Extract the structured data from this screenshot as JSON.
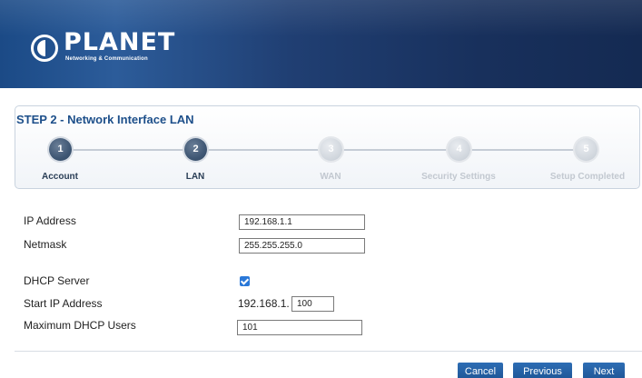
{
  "brand": {
    "logo_text": "PLANET",
    "tagline": "Networking & Communication",
    "colors": {
      "header": "#203f73",
      "accent": "#1d4f8a",
      "button": "#2566a8"
    }
  },
  "wizard": {
    "title": "STEP 2 - Network Interface LAN",
    "current_step": 2,
    "steps": [
      {
        "number": "1",
        "label": "Account",
        "state": "active"
      },
      {
        "number": "2",
        "label": "LAN",
        "state": "active"
      },
      {
        "number": "3",
        "label": "WAN",
        "state": "inactive"
      },
      {
        "number": "4",
        "label": "Security Settings",
        "state": "inactive"
      },
      {
        "number": "5",
        "label": "Setup Completed",
        "state": "inactive"
      }
    ]
  },
  "form": {
    "ip_address": {
      "label": "IP Address",
      "value": "192.168.1.1"
    },
    "netmask": {
      "label": "Netmask",
      "value": "255.255.255.0"
    },
    "dhcp_server": {
      "label": "DHCP Server",
      "checked": true
    },
    "start_ip": {
      "label": "Start IP Address",
      "prefix": "192.168.1.",
      "value": "100"
    },
    "max_users": {
      "label": "Maximum DHCP Users",
      "value": "101"
    }
  },
  "buttons": {
    "cancel": "Cancel",
    "previous": "Previous",
    "next": "Next"
  }
}
